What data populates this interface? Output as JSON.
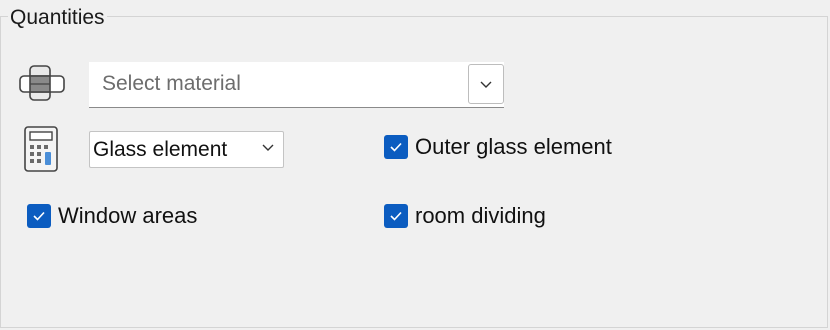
{
  "group": {
    "title": "Quantities"
  },
  "material": {
    "placeholder": "Select material",
    "icon": "material-layers-icon",
    "dropdown_icon": "chevron-down-icon"
  },
  "element_type": {
    "selected": "Glass element",
    "icon": "calculator-icon",
    "dropdown_icon": "chevron-down-icon"
  },
  "checkboxes": [
    {
      "label": "Outer glass element",
      "checked": true
    },
    {
      "label": "Window areas",
      "checked": true
    },
    {
      "label": "room dividing",
      "checked": true
    }
  ],
  "colors": {
    "accent": "#0b5cc0",
    "background": "#f0f0f0",
    "placeholder": "#6d6d6d"
  }
}
